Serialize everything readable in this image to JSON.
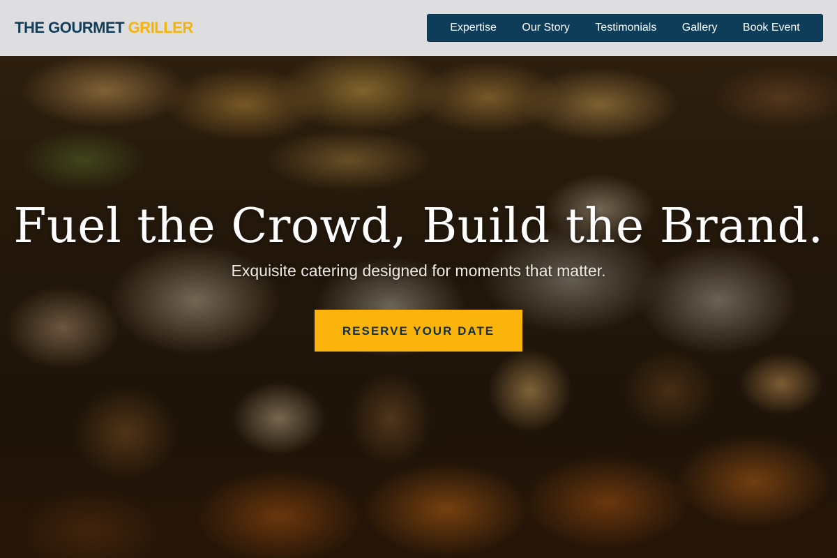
{
  "header": {
    "logo": {
      "part1": "THE GOURMET",
      "part2": "GRILLER"
    },
    "nav": [
      {
        "label": "Expertise"
      },
      {
        "label": "Our Story"
      },
      {
        "label": "Testimonials"
      },
      {
        "label": "Gallery"
      },
      {
        "label": "Book Event"
      }
    ]
  },
  "hero": {
    "background": "food-catering-photo",
    "title": "Fuel the Crowd, Build the Brand.",
    "subtitle": "Exquisite catering designed for moments that matter.",
    "cta_label": "RESERVE YOUR DATE"
  },
  "colors": {
    "brand_navy": "#0e3d5a",
    "brand_gold": "#fbb40c",
    "header_bg": "#ececf0"
  }
}
